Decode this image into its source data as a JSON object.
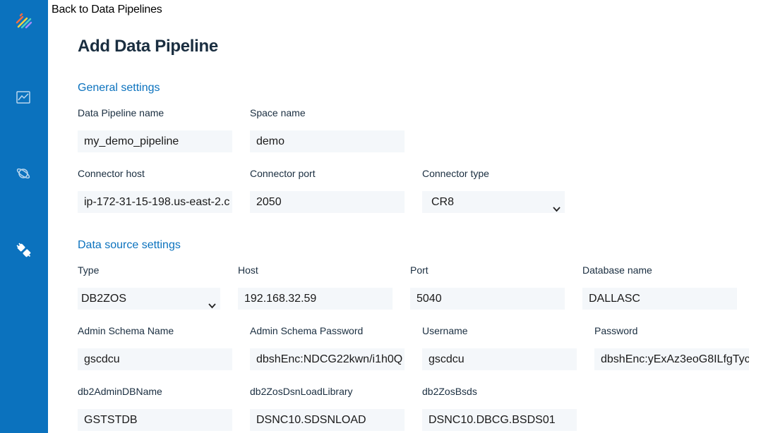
{
  "nav": {
    "back_label": "Back to Data Pipelines",
    "icons": [
      "pipelines-logo-icon",
      "chart-icon",
      "planet-icon",
      "plug-icon"
    ]
  },
  "page": {
    "title": "Add Data Pipeline"
  },
  "general": {
    "section_title": "General settings",
    "pipeline_name": {
      "label": "Data Pipeline name",
      "value": "my_demo_pipeline"
    },
    "space_name": {
      "label": "Space name",
      "value": "demo"
    },
    "connector_host": {
      "label": "Connector host",
      "value": "ip-172-31-15-198.us-east-2.c"
    },
    "connector_port": {
      "label": "Connector port",
      "value": "2050"
    },
    "connector_type": {
      "label": "Connector type",
      "value": "CR8"
    }
  },
  "datasource": {
    "section_title": "Data source settings",
    "type": {
      "label": "Type",
      "value": "DB2ZOS"
    },
    "host": {
      "label": "Host",
      "value": "192.168.32.59"
    },
    "port": {
      "label": "Port",
      "value": "5040"
    },
    "database_name": {
      "label": "Database name",
      "value": "DALLASC"
    },
    "admin_schema_name": {
      "label": "Admin Schema Name",
      "value": "gscdcu"
    },
    "admin_schema_password": {
      "label": "Admin Schema Password",
      "value": "dbshEnc:NDCG22kwn/i1h0Q"
    },
    "username": {
      "label": "Username",
      "value": "gscdcu"
    },
    "password": {
      "label": "Password",
      "value": "dbshEnc:yExAz3eoG8ILfgTyc"
    },
    "db2_admin_db_name": {
      "label": "db2AdminDBName",
      "value": "GSTSTDB"
    },
    "db2_zos_dsn_load_library": {
      "label": "db2ZosDsnLoadLibrary",
      "value": "DSNC10.SDSNLOAD"
    },
    "db2_zos_bsds": {
      "label": "db2ZosBsds",
      "value": "DSNC10.DBCG.BSDS01"
    }
  },
  "colors": {
    "sidebar": "#0b72be",
    "accent": "#0b72be",
    "input_bg": "#f4f7fa",
    "heading": "#1a2e40"
  }
}
